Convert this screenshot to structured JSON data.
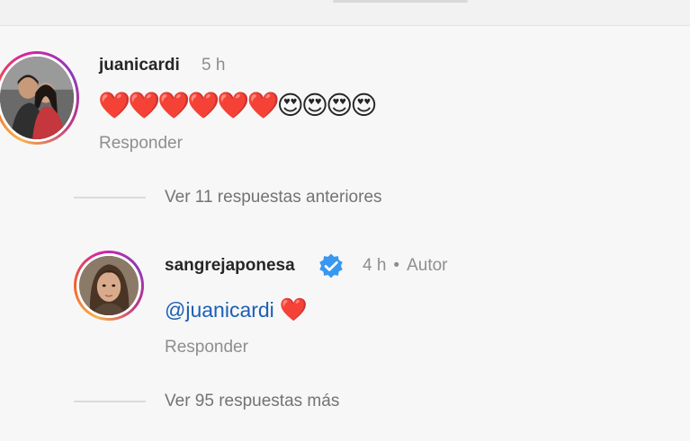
{
  "comment_1": {
    "username": "juanicardi",
    "time": "5 h",
    "text": "❤️❤️❤️❤️❤️❤️😍😍😍😍",
    "reply_label": "Responder",
    "avatar_icon": "profile-photo-couple"
  },
  "thread_1": {
    "label": "Ver 11 respuestas anteriores"
  },
  "reply_1": {
    "username": "sangrejaponesa",
    "verified_icon": "verified-badge-icon",
    "time": "4 h",
    "author_label": "Autor",
    "mention": "@juanicardi",
    "text_emoji": "❤️",
    "reply_label": "Responder",
    "avatar_icon": "profile-photo-woman"
  },
  "thread_2": {
    "label": "Ver 95 respuestas más"
  },
  "colors": {
    "mention": "#1a5fb4",
    "verified": "#3897f0",
    "secondary_text": "#8e8e8e"
  }
}
